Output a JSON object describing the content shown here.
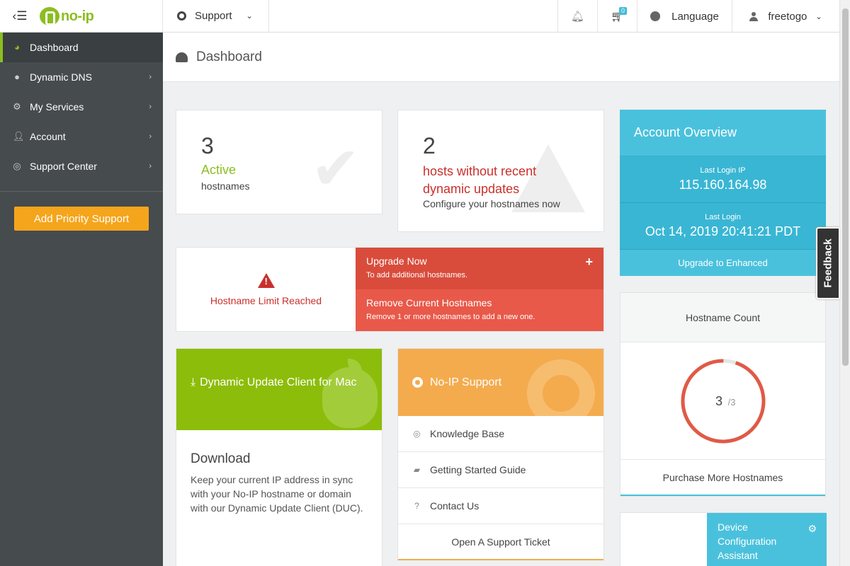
{
  "topbar": {
    "menu_toggle_icon": "sidebar-toggle-icon",
    "logo_text": "no-ip",
    "support_label": "Support",
    "cart_count": "0",
    "language_label": "Language",
    "username": "freetogo"
  },
  "sidebar": {
    "items": [
      {
        "label": "Dashboard",
        "icon": "dashboard-icon"
      },
      {
        "label": "Dynamic DNS",
        "icon": "globe-icon"
      },
      {
        "label": "My Services",
        "icon": "gear-icon"
      },
      {
        "label": "Account",
        "icon": "user-icon"
      },
      {
        "label": "Support Center",
        "icon": "lifebuoy-icon"
      }
    ],
    "priority_button": "Add Priority Support"
  },
  "page": {
    "title": "Dashboard"
  },
  "stats": {
    "active": {
      "number": "3",
      "label": "Active",
      "sub": "hostnames"
    },
    "outdated": {
      "number": "2",
      "label": "hosts without recent dynamic updates",
      "sub": "Configure your hostnames now"
    }
  },
  "limit": {
    "warning": "Hostname Limit Reached",
    "upgrade_title": "Upgrade Now",
    "upgrade_sub": "To add additional hostnames.",
    "remove_title": "Remove Current Hostnames",
    "remove_sub": "Remove 1 or more hostnames to add a new one."
  },
  "account": {
    "title": "Account Overview",
    "last_ip_label": "Last Login IP",
    "last_ip": "115.160.164.98",
    "last_login_label": "Last Login",
    "last_login": "Oct 14, 2019 20:41:21 PDT",
    "upgrade_link": "Upgrade to Enhanced"
  },
  "feedback_tab": "Feedback",
  "hostname_count": {
    "title": "Hostname Count",
    "used": "3",
    "total": "/3",
    "used_fraction": 0.95,
    "purchase": "Purchase More Hostnames"
  },
  "duc": {
    "title": "Dynamic Update Client for Mac",
    "download_heading": "Download",
    "description": "Keep your current IP address in sync with your No-IP hostname or domain with our Dynamic Update Client (DUC)."
  },
  "support": {
    "title": "No-IP Support",
    "items": [
      {
        "label": "Knowledge Base",
        "icon": "lifebuoy-icon"
      },
      {
        "label": "Getting Started Guide",
        "icon": "book-icon"
      },
      {
        "label": "Contact Us",
        "icon": "question-icon"
      }
    ],
    "ticket": "Open A Support Ticket"
  },
  "device": {
    "title": "Device Configuration Assistant"
  },
  "colors": {
    "brand_green": "#8cbd22",
    "accent_blue": "#4ac1dc",
    "danger_red": "#d94c3c",
    "support_orange": "#f4ab4e",
    "priority_orange": "#f5a51c",
    "gauge_red": "#e05a47"
  }
}
